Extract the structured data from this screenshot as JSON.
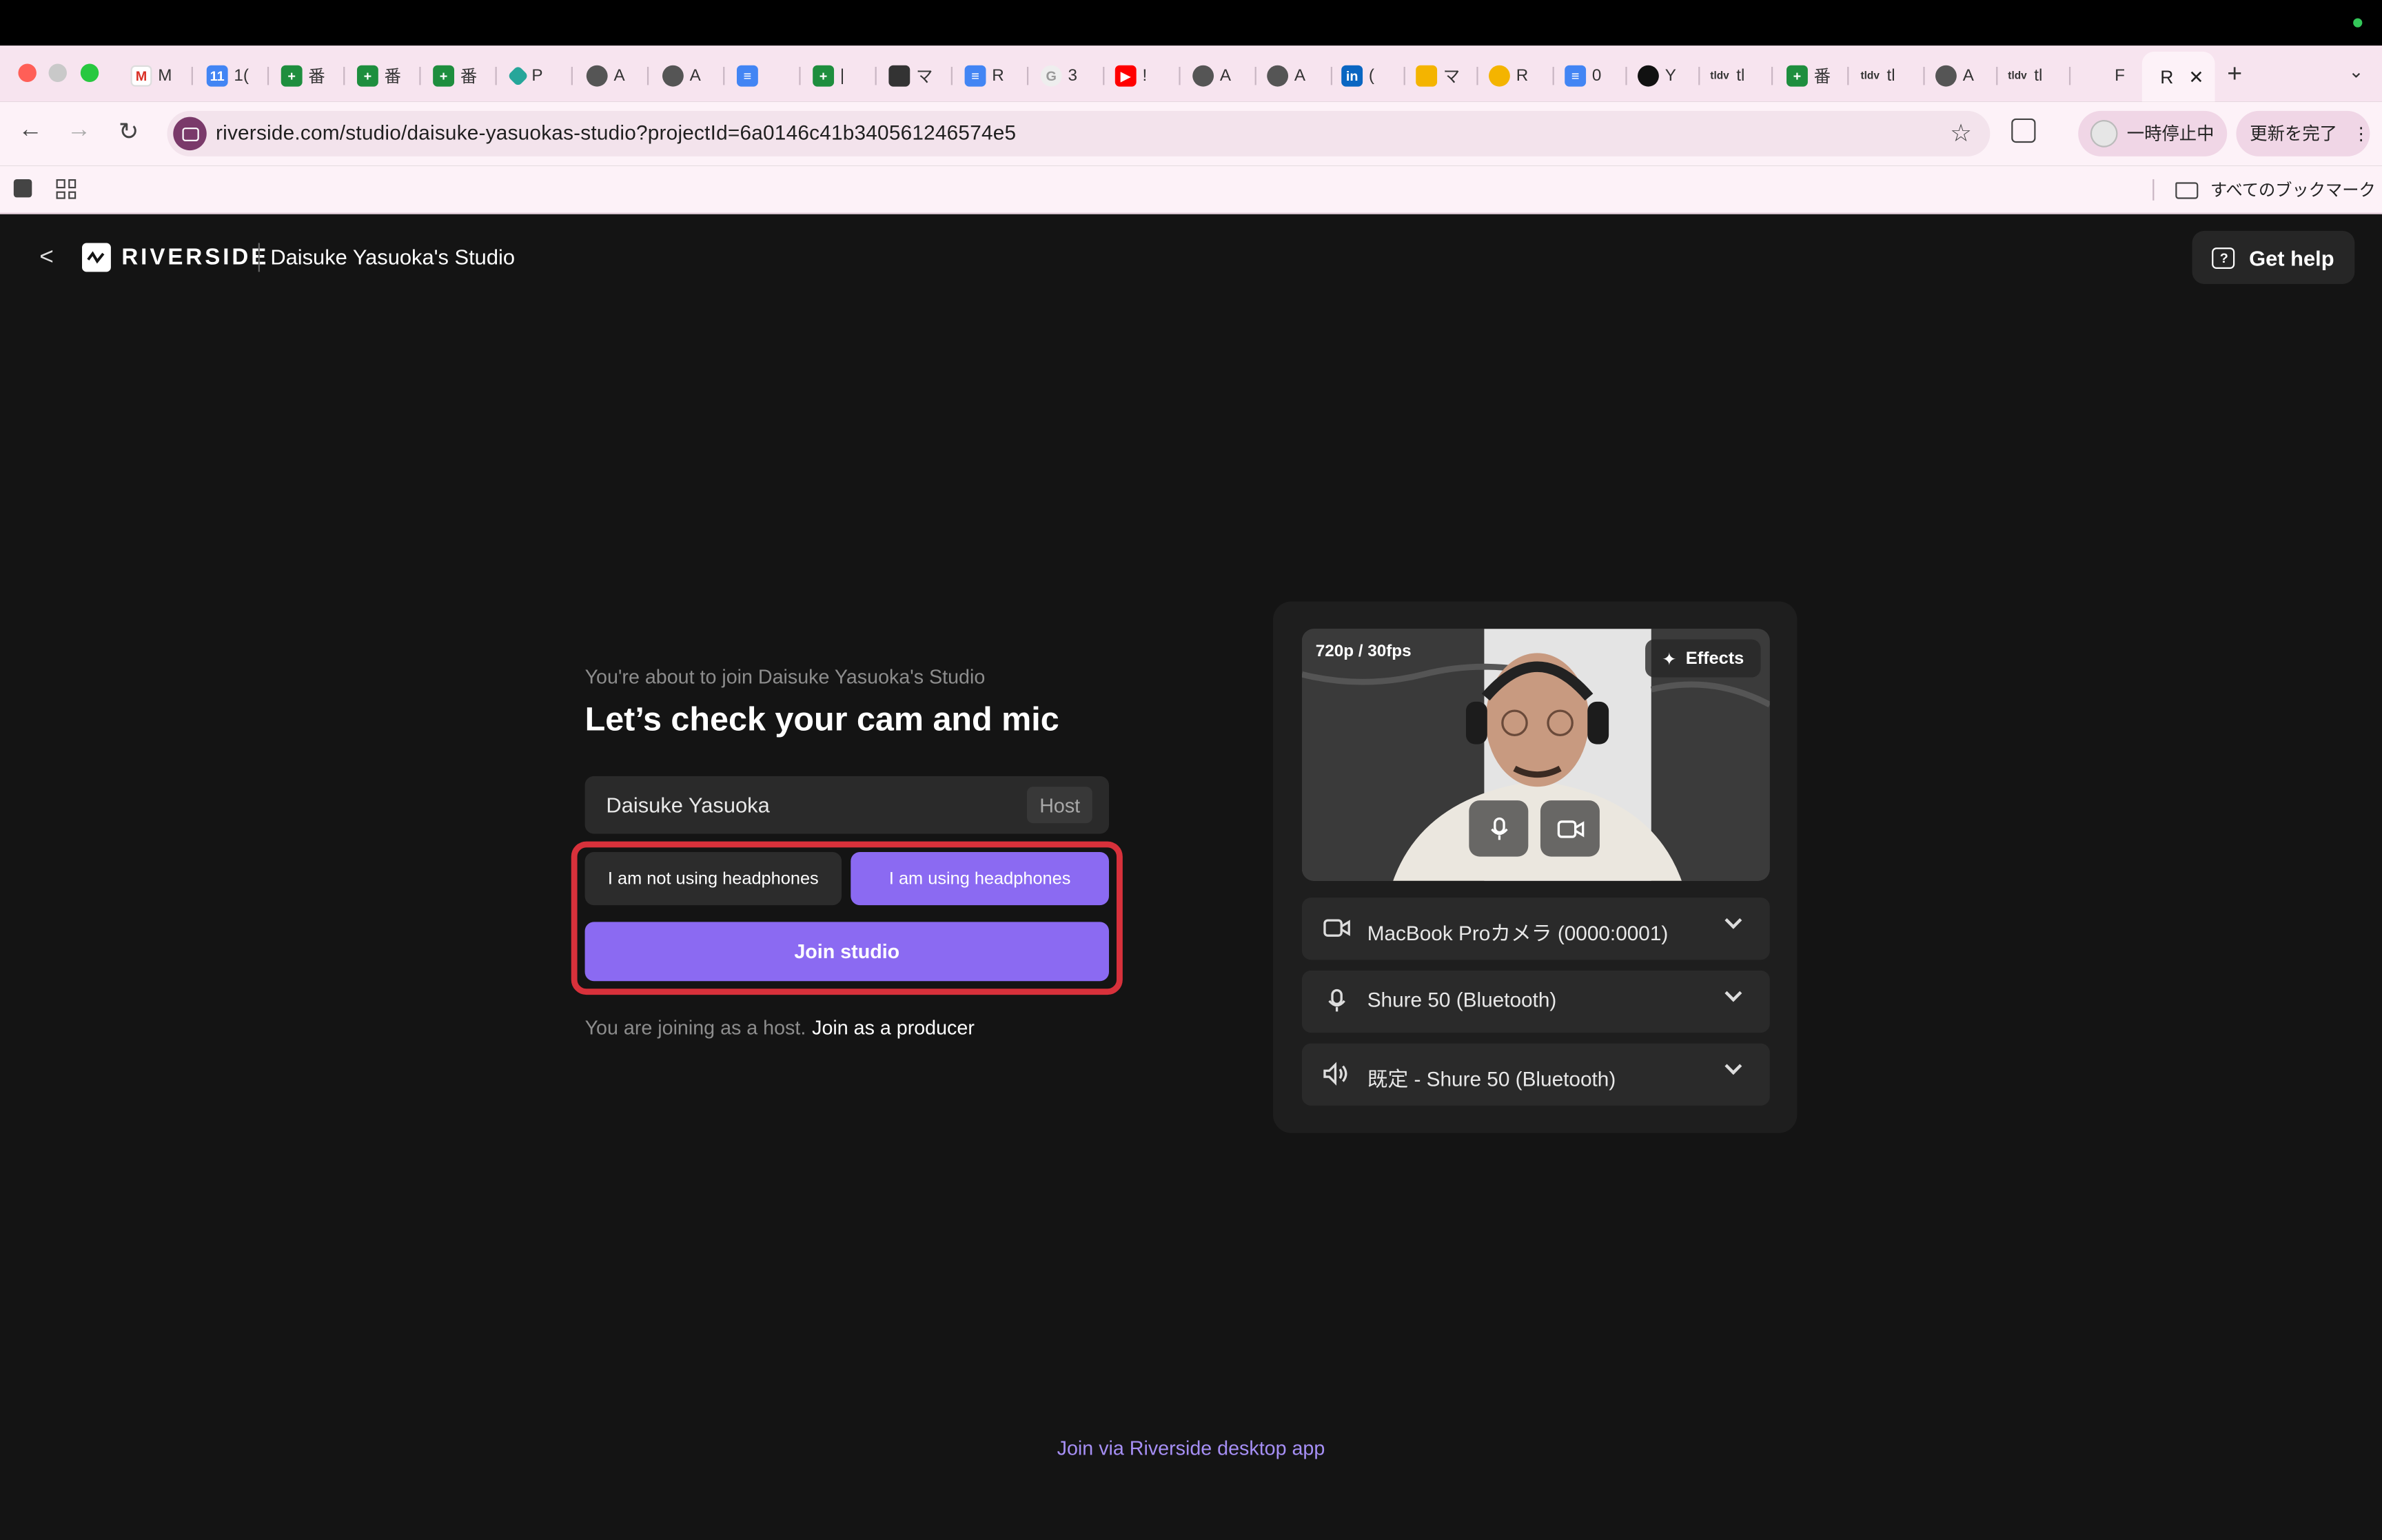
{
  "browser": {
    "tabs_visible": [
      "M",
      "1(",
      "番",
      "番",
      "番",
      "P",
      "A",
      "A",
      "",
      "|",
      "マ",
      "R",
      "3",
      "!",
      "A",
      "A",
      "(",
      "マ",
      "R",
      "0",
      "Y",
      "tl",
      "番",
      "tl",
      "A",
      "tl",
      "F"
    ],
    "active_tab_label": "R",
    "url": "riverside.com/studio/daisuke-yasuokas-studio?projectId=6a0146c41b340561246574e5",
    "paused_label": "一時停止中",
    "update_label": "更新を完了",
    "bookmarks_folder": "すべてのブックマーク"
  },
  "header": {
    "logo": "RIVERSIDE",
    "studio_name": "Daisuke Yasuoka's Studio",
    "help_label": "Get help"
  },
  "join": {
    "subtitle": "You're about to join Daisuke Yasuoka's Studio",
    "title": "Let’s check your cam and mic",
    "name_value": "Daisuke Yasuoka",
    "role_tag": "Host",
    "not_using_headphones": "I am not using headphones",
    "using_headphones": "I am using headphones",
    "join_button": "Join studio",
    "host_note": "You are joining as a host.",
    "producer_link": "Join as a producer"
  },
  "preview": {
    "quality": "720p / 30fps",
    "effects_label": "Effects",
    "camera": "MacBook Proカメラ (0000:0001)",
    "microphone": "Shure 50 (Bluetooth)",
    "speaker": "既定 - Shure 50 (Bluetooth)"
  },
  "footer": {
    "desktop_link": "Join via Riverside desktop app"
  },
  "colors": {
    "background": "#141414",
    "accent_purple": "#8b6af2",
    "highlight_red": "#d8313b",
    "link_purple": "#a68ff5"
  }
}
